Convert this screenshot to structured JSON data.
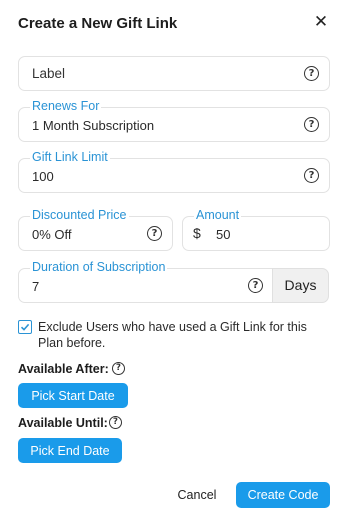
{
  "dialog": {
    "title": "Create a New Gift Link",
    "close_icon": "close-icon",
    "close_glyph": "✕"
  },
  "fields": {
    "label": {
      "placeholder": "Label"
    },
    "renews_for": {
      "label": "Renews For",
      "value": "1 Month Subscription"
    },
    "gift_link_limit": {
      "label": "Gift Link Limit",
      "value": "100"
    },
    "discounted_price": {
      "label": "Discounted Price",
      "value": "0% Off"
    },
    "amount": {
      "label": "Amount",
      "currency": "$",
      "value": "50"
    },
    "duration": {
      "label": "Duration of Subscription",
      "value": "7",
      "unit": "Days"
    }
  },
  "help_glyph": "?",
  "exclude_checkbox": {
    "checked": true,
    "label": "Exclude Users who have used a Gift Link for this Plan before."
  },
  "available_after": {
    "label": "Available After:",
    "button": "Pick Start Date"
  },
  "available_until": {
    "label": "Available Until:",
    "button": "Pick End Date"
  },
  "footer": {
    "cancel": "Cancel",
    "create": "Create Code"
  },
  "colors": {
    "accent": "#2a93d5",
    "button": "#1a9bea"
  }
}
